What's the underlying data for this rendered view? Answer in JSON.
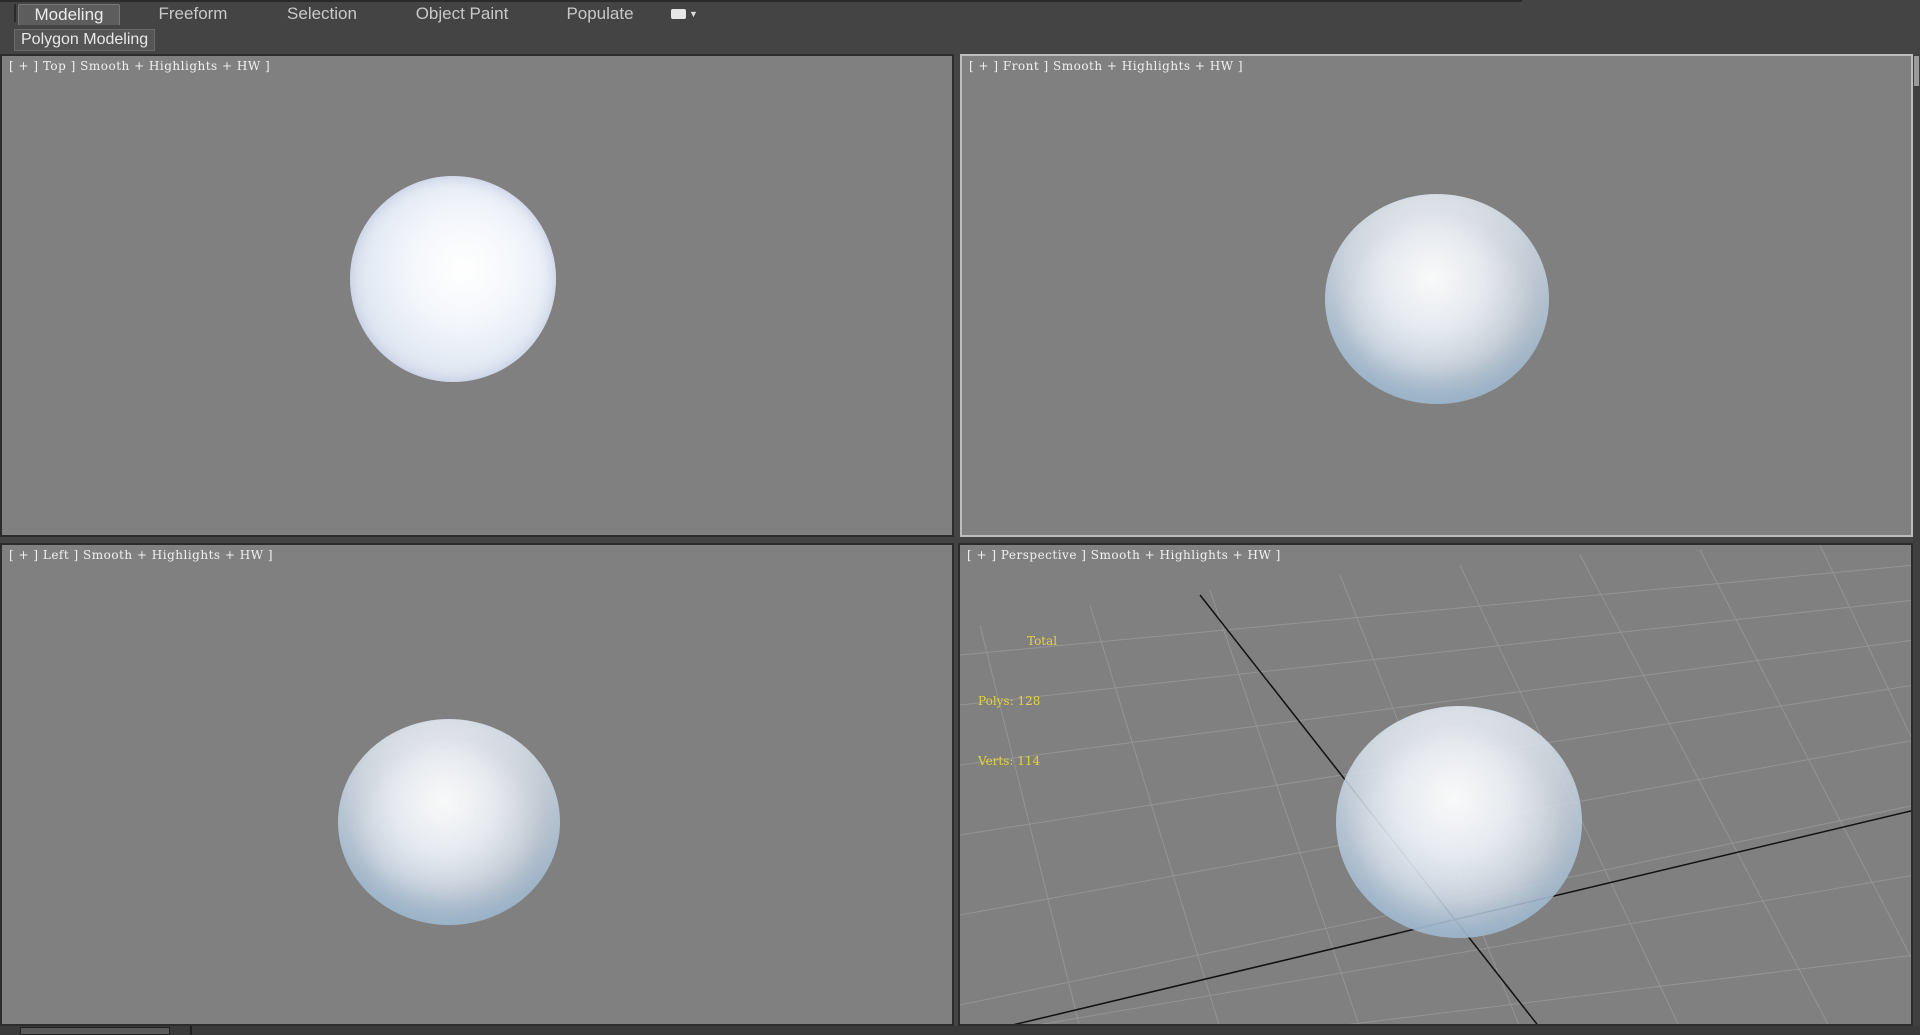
{
  "ribbon": {
    "tabs": [
      {
        "label": "Modeling",
        "active": true
      },
      {
        "label": "Freeform",
        "active": false
      },
      {
        "label": "Selection",
        "active": false
      },
      {
        "label": "Object Paint",
        "active": false
      },
      {
        "label": "Populate",
        "active": false
      }
    ],
    "menu_icon": "ribbon-options-icon"
  },
  "panel": {
    "label": "Polygon Modeling"
  },
  "viewports": {
    "top": {
      "label": "[ + ] Top ] Smooth + Highlights + HW ]"
    },
    "front": {
      "label": "[ + ] Front ] Smooth + Highlights + HW ]"
    },
    "left": {
      "label": "[ + ] Left ] Smooth + Highlights + HW ]"
    },
    "perspective": {
      "label": "[ + ] Perspective ] Smooth + Highlights + HW ]"
    }
  },
  "stats": {
    "title": "Total",
    "polys": "Polys: 128",
    "verts": "Verts: 114"
  },
  "colors": {
    "viewport_bg": "#808080",
    "stats_text": "#e8d23a",
    "ui_bg": "#444444"
  }
}
